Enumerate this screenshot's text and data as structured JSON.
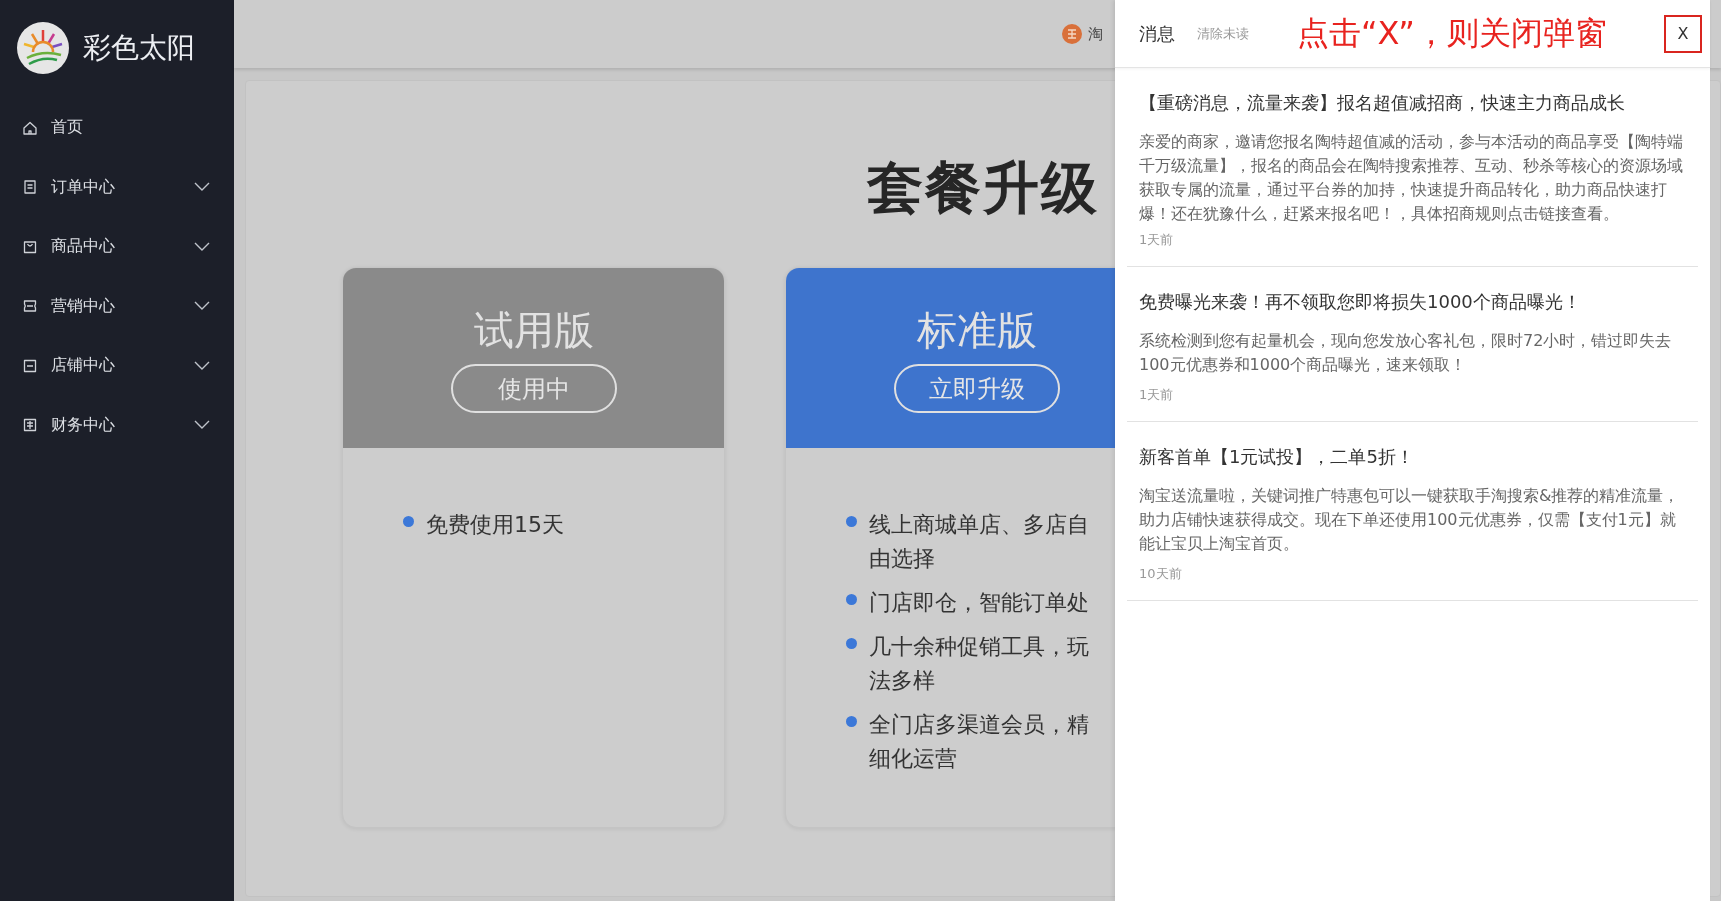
{
  "sidebar": {
    "brand": "彩色太阳",
    "items": [
      {
        "label": "首页",
        "has_submenu": false
      },
      {
        "label": "订单中心",
        "has_submenu": true
      },
      {
        "label": "商品中心",
        "has_submenu": true
      },
      {
        "label": "营销中心",
        "has_submenu": true
      },
      {
        "label": "店铺中心",
        "has_submenu": true
      },
      {
        "label": "财务中心",
        "has_submenu": true
      }
    ]
  },
  "top_bar": {
    "shop_label": "淘"
  },
  "page": {
    "title": "套餐升级",
    "plans": [
      {
        "name": "试用版",
        "button": "使用中",
        "kind": "current",
        "features": [
          "免费使用15天"
        ]
      },
      {
        "name": "标准版",
        "button": "立即升级",
        "kind": "upgrade",
        "features": [
          "线上商城单店、多店自由选择",
          "门店即仓，智能订单处",
          "几十余种促销工具，玩法多样",
          "全门店多渠道会员，精细化运营"
        ]
      }
    ]
  },
  "drawer": {
    "title": "消息",
    "clear_unread": "清除未读",
    "annotation": "点击“X”，则关闭弹窗",
    "close": "X",
    "messages": [
      {
        "title": "【重磅消息，流量来袭】报名超值减招商，快速主力商品成长",
        "body": "亲爱的商家，邀请您报名陶特超值减的活动，参与本活动的商品享受【陶特端千万级流量】，报名的商品会在陶特搜索推荐、互动、秒杀等核心的资源场域获取专属的流量，通过平台券的加持，快速提升商品转化，助力商品快速打爆！还在犹豫什么，赶紧来报名吧！，具体招商规则点击链接查看。",
        "time": "1天前"
      },
      {
        "title": "免费曝光来袭！再不领取您即将损失1000个商品曝光！",
        "body": "系统检测到您有起量机会，现向您发放心客礼包，限时72小时，错过即失去100元优惠券和1000个商品曝光，速来领取！",
        "time": "1天前"
      },
      {
        "title": "新客首单【1元试投】，二单5折！",
        "body": "淘宝送流量啦，关键词推广特惠包可以一键获取手淘搜索&推荐的精准流量，助力店铺快速获得成交。现在下单还使用100元优惠券，仅需【支付1元】就能让宝贝上淘宝首页。",
        "time": "10天前"
      }
    ]
  }
}
